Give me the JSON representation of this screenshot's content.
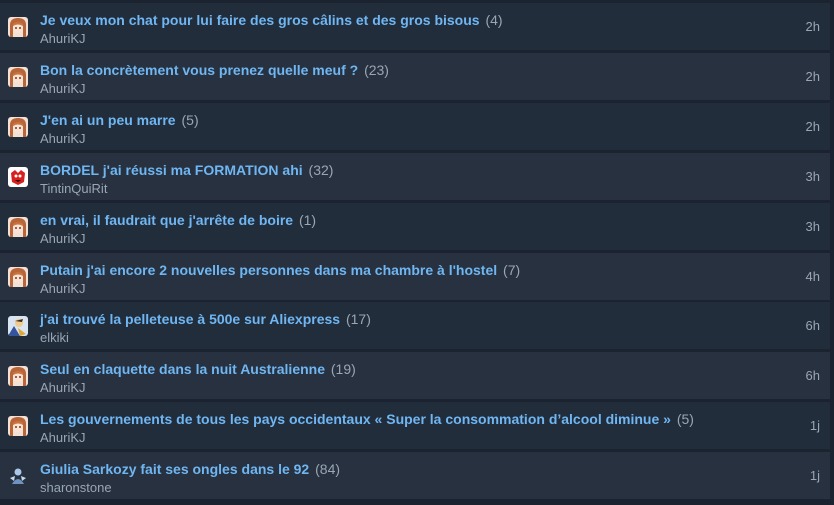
{
  "topics": [
    {
      "title": "Je veux mon chat pour lui faire des gros câlins et des gros bisous",
      "count": "(4)",
      "author": "AhuriKJ",
      "time": "2h",
      "avatar": "anime-girl-avatar"
    },
    {
      "title": "Bon la concrètement vous prenez quelle meuf ?",
      "count": "(23)",
      "author": "AhuriKJ",
      "time": "2h",
      "avatar": "anime-girl-avatar"
    },
    {
      "title": "J'en ai un peu marre",
      "count": "(5)",
      "author": "AhuriKJ",
      "time": "2h",
      "avatar": "anime-girl-avatar"
    },
    {
      "title": "BORDEL j'ai réussi ma FORMATION ahi",
      "count": "(32)",
      "author": "TintinQuiRit",
      "time": "3h",
      "avatar": "red-creature-avatar"
    },
    {
      "title": "en vrai, il faudrait que j'arrête de boire",
      "count": "(1)",
      "author": "AhuriKJ",
      "time": "3h",
      "avatar": "anime-girl-avatar"
    },
    {
      "title": "Putain j'ai encore 2 nouvelles personnes dans ma chambre à l'hostel",
      "count": "(7)",
      "author": "AhuriKJ",
      "time": "4h",
      "avatar": "anime-girl-avatar"
    },
    {
      "title": "j'ai trouvé la pelleteuse à 500e sur Aliexpress",
      "count": "(17)",
      "author": "elkiki",
      "time": "6h",
      "avatar": "character-avatar"
    },
    {
      "title": "Seul en claquette dans la nuit Australienne",
      "count": "(19)",
      "author": "AhuriKJ",
      "time": "6h",
      "avatar": "anime-girl-avatar"
    },
    {
      "title": "Les gouvernements de tous les pays occidentaux « Super la consommation d’alcool diminue »",
      "count": "(5)",
      "author": "AhuriKJ",
      "time": "1j",
      "avatar": "anime-girl-avatar"
    },
    {
      "title": "Giulia Sarkozy fait ses ongles dans le 92",
      "count": "(84)",
      "author": "sharonstone",
      "time": "1j",
      "avatar": "blue-figure-avatar"
    }
  ]
}
